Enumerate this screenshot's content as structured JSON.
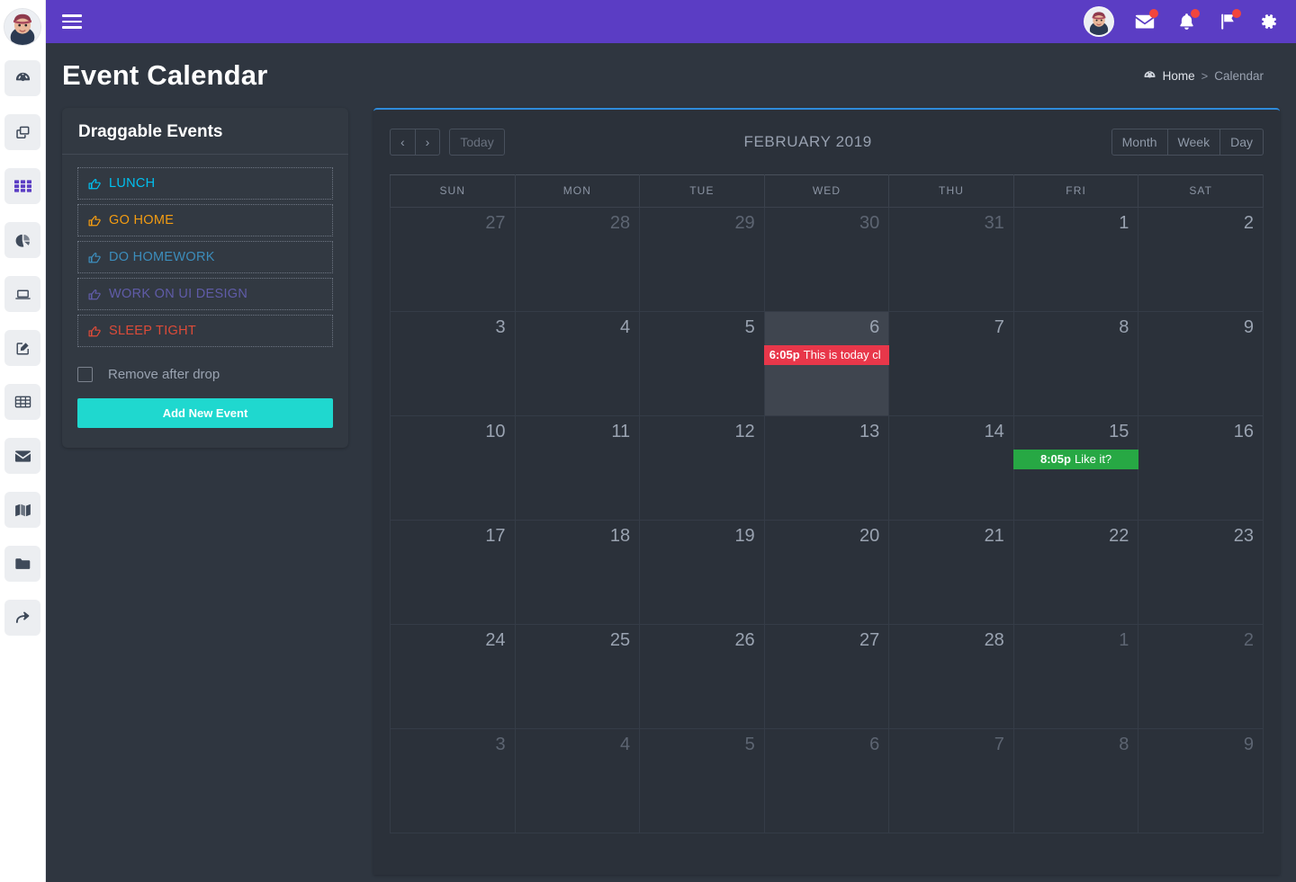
{
  "theme": {
    "topbar_bg": "#5b3dc4",
    "page_bg": "#2f3640",
    "card_bg": "#323942",
    "calendar_bg": "#2b313a",
    "accent_blue": "#2f8bdb",
    "accent_teal": "#1fd8cf",
    "badge_red": "#f2453d"
  },
  "topbar": {
    "menu_toggle_label": "Toggle navigation",
    "icons": [
      {
        "name": "messages-icon",
        "badge": true
      },
      {
        "name": "notifications-icon",
        "badge": true
      },
      {
        "name": "flag-icon",
        "badge": true
      },
      {
        "name": "settings-icon",
        "badge": false
      }
    ]
  },
  "rail": {
    "items": [
      {
        "name": "dashboard-icon",
        "label": "Dashboard"
      },
      {
        "name": "layers-icon",
        "label": "Layouts"
      },
      {
        "name": "grid-icon",
        "label": "Widgets"
      },
      {
        "name": "pie-chart-icon",
        "label": "Charts"
      },
      {
        "name": "laptop-icon",
        "label": "UI Elements"
      },
      {
        "name": "edit-icon",
        "label": "Forms"
      },
      {
        "name": "table-icon",
        "label": "Tables"
      },
      {
        "name": "mail-icon",
        "label": "Mailbox"
      },
      {
        "name": "map-icon",
        "label": "Maps"
      },
      {
        "name": "folder-icon",
        "label": "Pages"
      },
      {
        "name": "share-icon",
        "label": "Extras"
      }
    ]
  },
  "header": {
    "title": "Event Calendar",
    "breadcrumb": {
      "home": "Home",
      "separator": ">",
      "current": "Calendar"
    }
  },
  "draggable_panel": {
    "title": "Draggable Events",
    "events": [
      {
        "label": "LUNCH",
        "color": "#00c0ef"
      },
      {
        "label": "GO HOME",
        "color": "#f39c12"
      },
      {
        "label": "DO HOMEWORK",
        "color": "#3c8dbc"
      },
      {
        "label": "WORK ON UI DESIGN",
        "color": "#605ca8"
      },
      {
        "label": "SLEEP TIGHT",
        "color": "#dd4b39"
      }
    ],
    "checkbox_label": "Remove after drop",
    "checkbox_checked": false,
    "add_button_label": "Add New Event"
  },
  "calendar": {
    "toolbar": {
      "prev_label": "‹",
      "next_label": "›",
      "today_label": "Today",
      "title": "FEBRUARY 2019",
      "views": [
        "Month",
        "Week",
        "Day"
      ],
      "active_view": "Month"
    },
    "weekday_headers": [
      "SUN",
      "MON",
      "TUE",
      "WED",
      "THU",
      "FRI",
      "SAT"
    ],
    "weeks": [
      [
        {
          "day": "27",
          "other_month": true
        },
        {
          "day": "28",
          "other_month": true
        },
        {
          "day": "29",
          "other_month": true
        },
        {
          "day": "30",
          "other_month": true
        },
        {
          "day": "31",
          "other_month": true
        },
        {
          "day": "1",
          "other_month": false
        },
        {
          "day": "2",
          "other_month": false
        }
      ],
      [
        {
          "day": "3",
          "other_month": false
        },
        {
          "day": "4",
          "other_month": false
        },
        {
          "day": "5",
          "other_month": false
        },
        {
          "day": "6",
          "other_month": false,
          "today": true,
          "events": [
            {
              "time": "6:05p",
              "title": "This is today cl",
              "bg": "#e8374a",
              "align": "left"
            }
          ]
        },
        {
          "day": "7",
          "other_month": false
        },
        {
          "day": "8",
          "other_month": false
        },
        {
          "day": "9",
          "other_month": false
        }
      ],
      [
        {
          "day": "10",
          "other_month": false
        },
        {
          "day": "11",
          "other_month": false
        },
        {
          "day": "12",
          "other_month": false
        },
        {
          "day": "13",
          "other_month": false
        },
        {
          "day": "14",
          "other_month": false
        },
        {
          "day": "15",
          "other_month": false,
          "events": [
            {
              "time": "8:05p",
              "title": "Like it?",
              "bg": "#27a844",
              "align": "center"
            }
          ]
        },
        {
          "day": "16",
          "other_month": false
        }
      ],
      [
        {
          "day": "17",
          "other_month": false
        },
        {
          "day": "18",
          "other_month": false
        },
        {
          "day": "19",
          "other_month": false
        },
        {
          "day": "20",
          "other_month": false
        },
        {
          "day": "21",
          "other_month": false
        },
        {
          "day": "22",
          "other_month": false
        },
        {
          "day": "23",
          "other_month": false
        }
      ],
      [
        {
          "day": "24",
          "other_month": false
        },
        {
          "day": "25",
          "other_month": false
        },
        {
          "day": "26",
          "other_month": false
        },
        {
          "day": "27",
          "other_month": false
        },
        {
          "day": "28",
          "other_month": false
        },
        {
          "day": "1",
          "other_month": true
        },
        {
          "day": "2",
          "other_month": true
        }
      ],
      [
        {
          "day": "3",
          "other_month": true
        },
        {
          "day": "4",
          "other_month": true
        },
        {
          "day": "5",
          "other_month": true
        },
        {
          "day": "6",
          "other_month": true
        },
        {
          "day": "7",
          "other_month": true
        },
        {
          "day": "8",
          "other_month": true
        },
        {
          "day": "9",
          "other_month": true
        }
      ]
    ]
  }
}
